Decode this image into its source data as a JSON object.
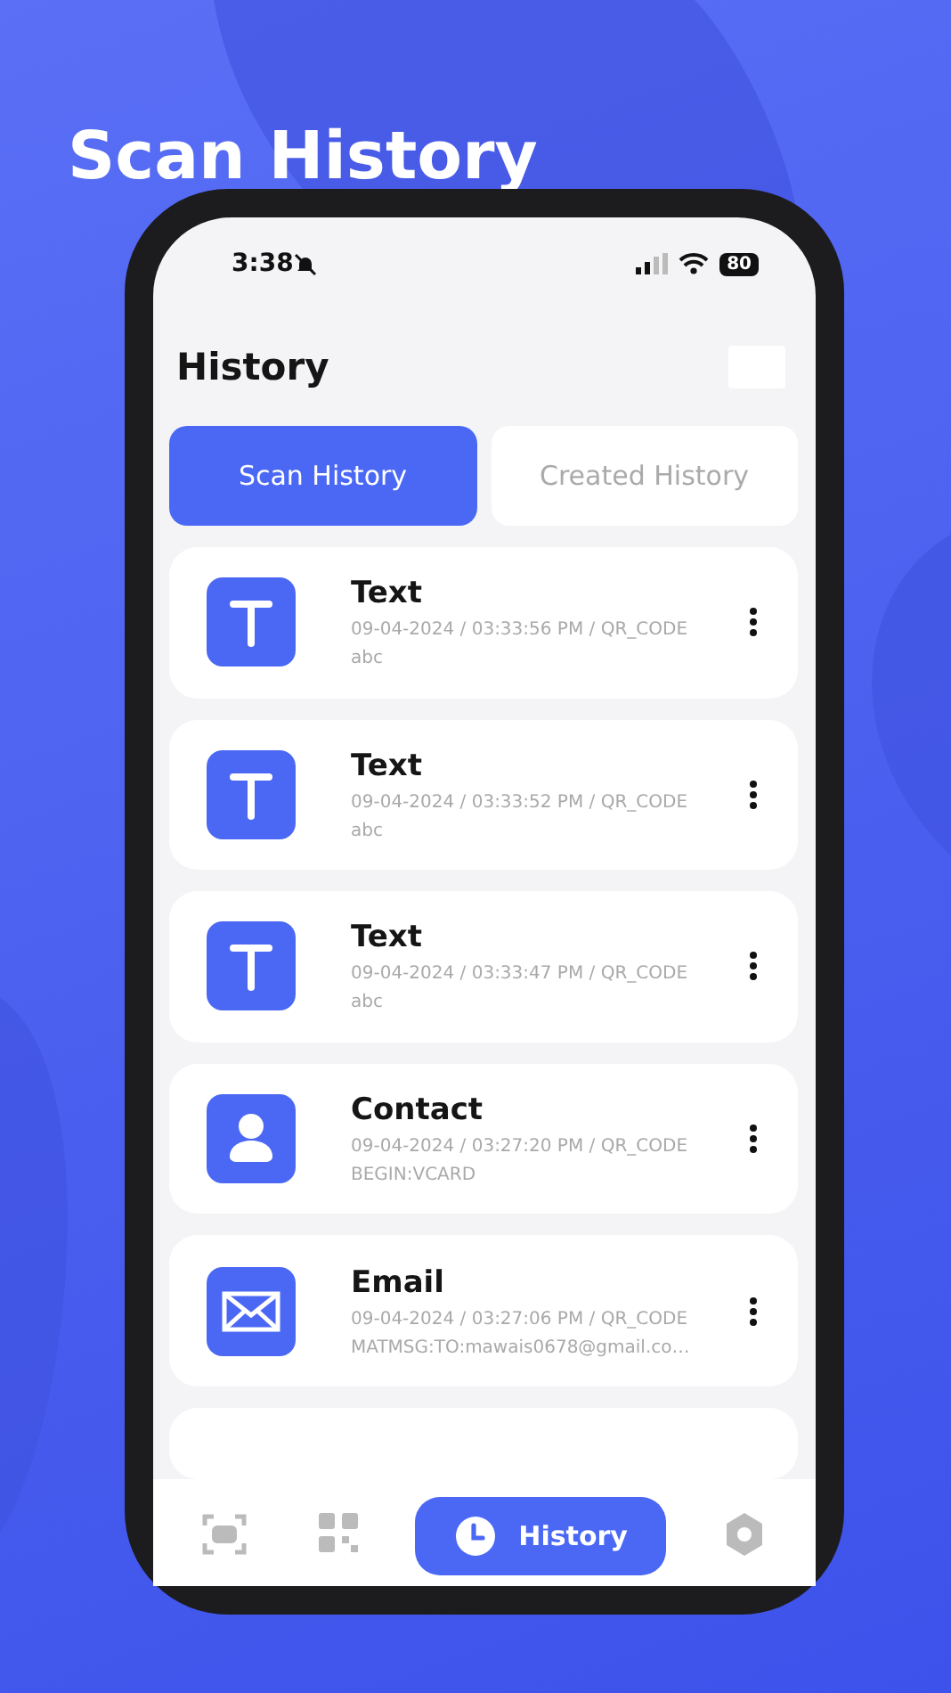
{
  "headline": "Scan History",
  "status_bar": {
    "time": "3:38",
    "silent": true,
    "battery": "80"
  },
  "screen_title": "History",
  "tabs": [
    {
      "label": "Scan History",
      "selected": true
    },
    {
      "label": "Created History",
      "selected": false
    }
  ],
  "items": [
    {
      "kind": "text",
      "title": "Text",
      "meta": "09-04-2024 / 03:33:56 PM / QR_CODE",
      "content": "abc"
    },
    {
      "kind": "text",
      "title": "Text",
      "meta": "09-04-2024 / 03:33:52 PM / QR_CODE",
      "content": "abc"
    },
    {
      "kind": "text",
      "title": "Text",
      "meta": "09-04-2024 / 03:33:47 PM / QR_CODE",
      "content": "abc"
    },
    {
      "kind": "contact",
      "title": "Contact",
      "meta": "09-04-2024 / 03:27:20 PM / QR_CODE",
      "content": "BEGIN:VCARD"
    },
    {
      "kind": "email",
      "title": "Email",
      "meta": "09-04-2024 / 03:27:06 PM / QR_CODE",
      "content": "MATMSG:TO:mawais0678@gmail.co…"
    }
  ],
  "nav": [
    {
      "kind": "scan",
      "selected": false
    },
    {
      "kind": "qr",
      "selected": false
    },
    {
      "kind": "history",
      "label": "History",
      "selected": true
    },
    {
      "kind": "settings",
      "selected": false
    }
  ]
}
